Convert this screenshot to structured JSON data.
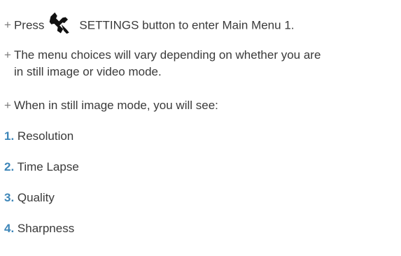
{
  "intro": {
    "bullet_symbol": "+",
    "line1_before": "Press",
    "line1_icon": "wrench-icon",
    "line1_after": "SETTINGS button to enter Main Menu 1.",
    "line2a": "The menu choices will vary depending on whether you are",
    "line2b": "in still image or video mode.",
    "line3": "When in still image mode, you will see:"
  },
  "menu_items": [
    {
      "number": "1.",
      "label": "Resolution"
    },
    {
      "number": "2.",
      "label": "Time Lapse"
    },
    {
      "number": "3.",
      "label": "Quality"
    },
    {
      "number": "4.",
      "label": "Sharpness"
    }
  ],
  "colors": {
    "text": "#3a3a3a",
    "bullet": "#7a7a7a",
    "number_accent": "#3d86b8"
  }
}
